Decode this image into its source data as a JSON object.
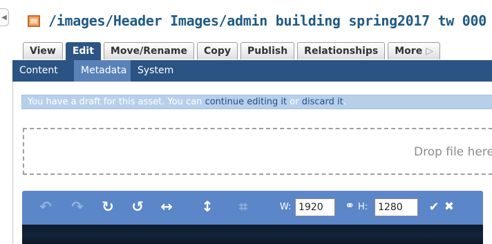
{
  "collapse_handle": {
    "glyph": "◀"
  },
  "header": {
    "path": "/images/Header Images/admin building spring2017 tw 000",
    "file_icon": "image-file-icon"
  },
  "action_tabs": [
    {
      "label": "View"
    },
    {
      "label": "Edit"
    },
    {
      "label": "Move/Rename"
    },
    {
      "label": "Copy"
    },
    {
      "label": "Publish"
    },
    {
      "label": "Relationships"
    },
    {
      "label": "More"
    }
  ],
  "more_chevron": "▷",
  "subtabs": [
    {
      "label": "Content"
    },
    {
      "label": "Metadata"
    },
    {
      "label": "System"
    }
  ],
  "draft_notice": {
    "prefix": "You have a draft for this asset. You can ",
    "continue_link": "continue editing it",
    "middle": " or ",
    "discard_link": "discard it",
    "suffix": "."
  },
  "drop_zone": {
    "text": "Drop file here"
  },
  "image_editor": {
    "tools": {
      "undo": "↶",
      "redo": "↷",
      "rotate_cw": "↻",
      "rotate_ccw": "↺",
      "flip_horizontal": "↔",
      "flip_vertical": "↕",
      "crop": "⌗"
    },
    "width_label": "W:",
    "width_value": "1920",
    "height_label": "H:",
    "height_value": "1280",
    "link_icon": "⚭",
    "apply_icon": "✔",
    "cancel_icon": "✖"
  },
  "colors": {
    "title": "#1f5a84",
    "active_tab": "#2c5586",
    "subtab_bar": "#2b5384",
    "active_subtab": "#5a82b8",
    "notice_bg": "#b7d0ea",
    "editor_toolbar": "#5b86c8"
  }
}
